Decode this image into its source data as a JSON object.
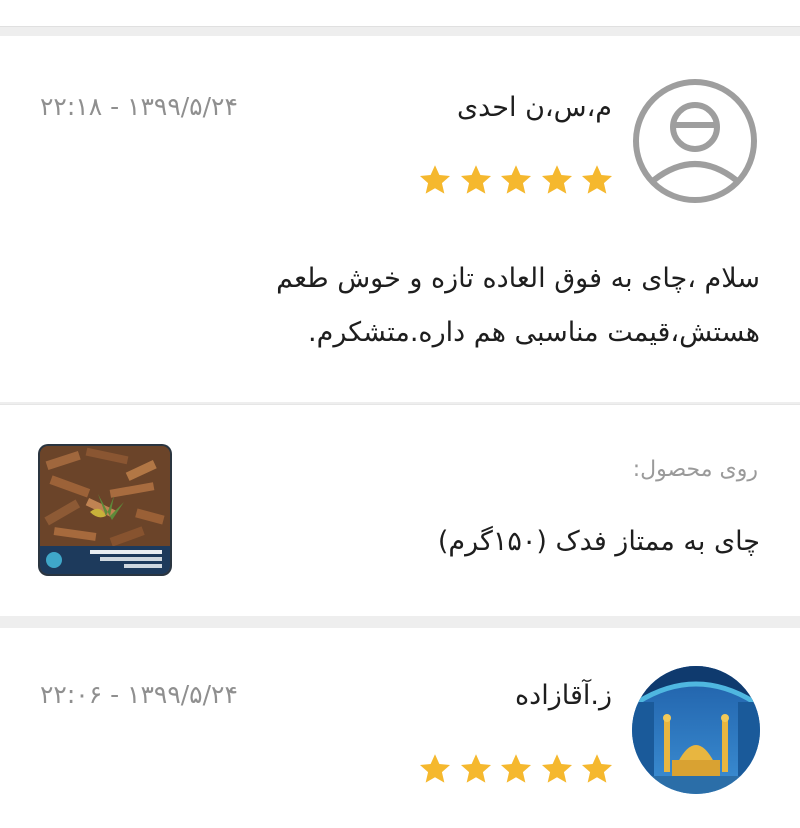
{
  "reviews": [
    {
      "name": "م،س،ن احدی",
      "date": "۲۲:۱۸ - ۱۳۹۹/۵/۲۴",
      "rating": 5,
      "comment": "سلام ،چای به فوق العاده تازه و خوش طعم هستش،قیمت مناسبی هم داره.متشکرم.",
      "avatar_icon": "user-outline-icon"
    },
    {
      "name": "ز.آقازاده",
      "date": "۲۲:۰۶ - ۱۳۹۹/۵/۲۴",
      "rating": 5,
      "avatar_icon": "shrine-photo"
    }
  ],
  "product": {
    "label": "روی محصول:",
    "name": "چای به ممتاز فدک (۱۵۰گرم)"
  },
  "colors": {
    "star": "#f5b82e",
    "date_text": "#8f8f8f",
    "avatar_outline": "#9e9e9e",
    "card_background": "#ffffff",
    "page_background": "#eeeeee"
  }
}
